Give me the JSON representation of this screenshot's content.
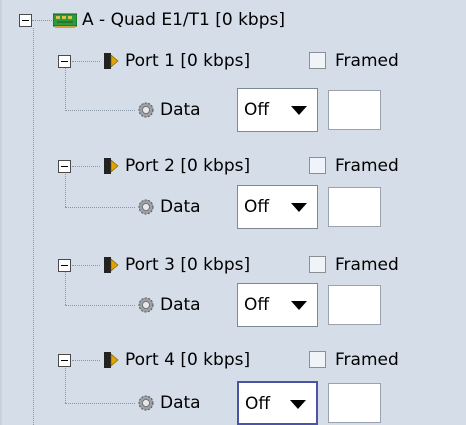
{
  "card": {
    "label": "A - Quad E1/T1 [0 kbps]",
    "icon": "card-icon"
  },
  "ports": [
    {
      "label": "Port 1 [0 kbps]",
      "framed_label": "Framed",
      "framed_checked": false,
      "data_label": "Data",
      "data_value": "Off",
      "text_value": ""
    },
    {
      "label": "Port 2 [0 kbps]",
      "framed_label": "Framed",
      "framed_checked": false,
      "data_label": "Data",
      "data_value": "Off",
      "text_value": ""
    },
    {
      "label": "Port 3 [0 kbps]",
      "framed_label": "Framed",
      "framed_checked": false,
      "data_label": "Data",
      "data_value": "Off",
      "text_value": ""
    },
    {
      "label": "Port 4 [0 kbps]",
      "framed_label": "Framed",
      "framed_checked": false,
      "data_label": "Data",
      "data_value": "Off",
      "text_value": ""
    }
  ],
  "colors": {
    "background": "#d4dde8",
    "focus_border": "#4b55a3"
  },
  "icons": {
    "card": "card-icon",
    "port": "port-icon",
    "data": "data-gear-icon",
    "toggle": "collapse-icon",
    "dropdown_arrow": "chevron-down-icon"
  }
}
